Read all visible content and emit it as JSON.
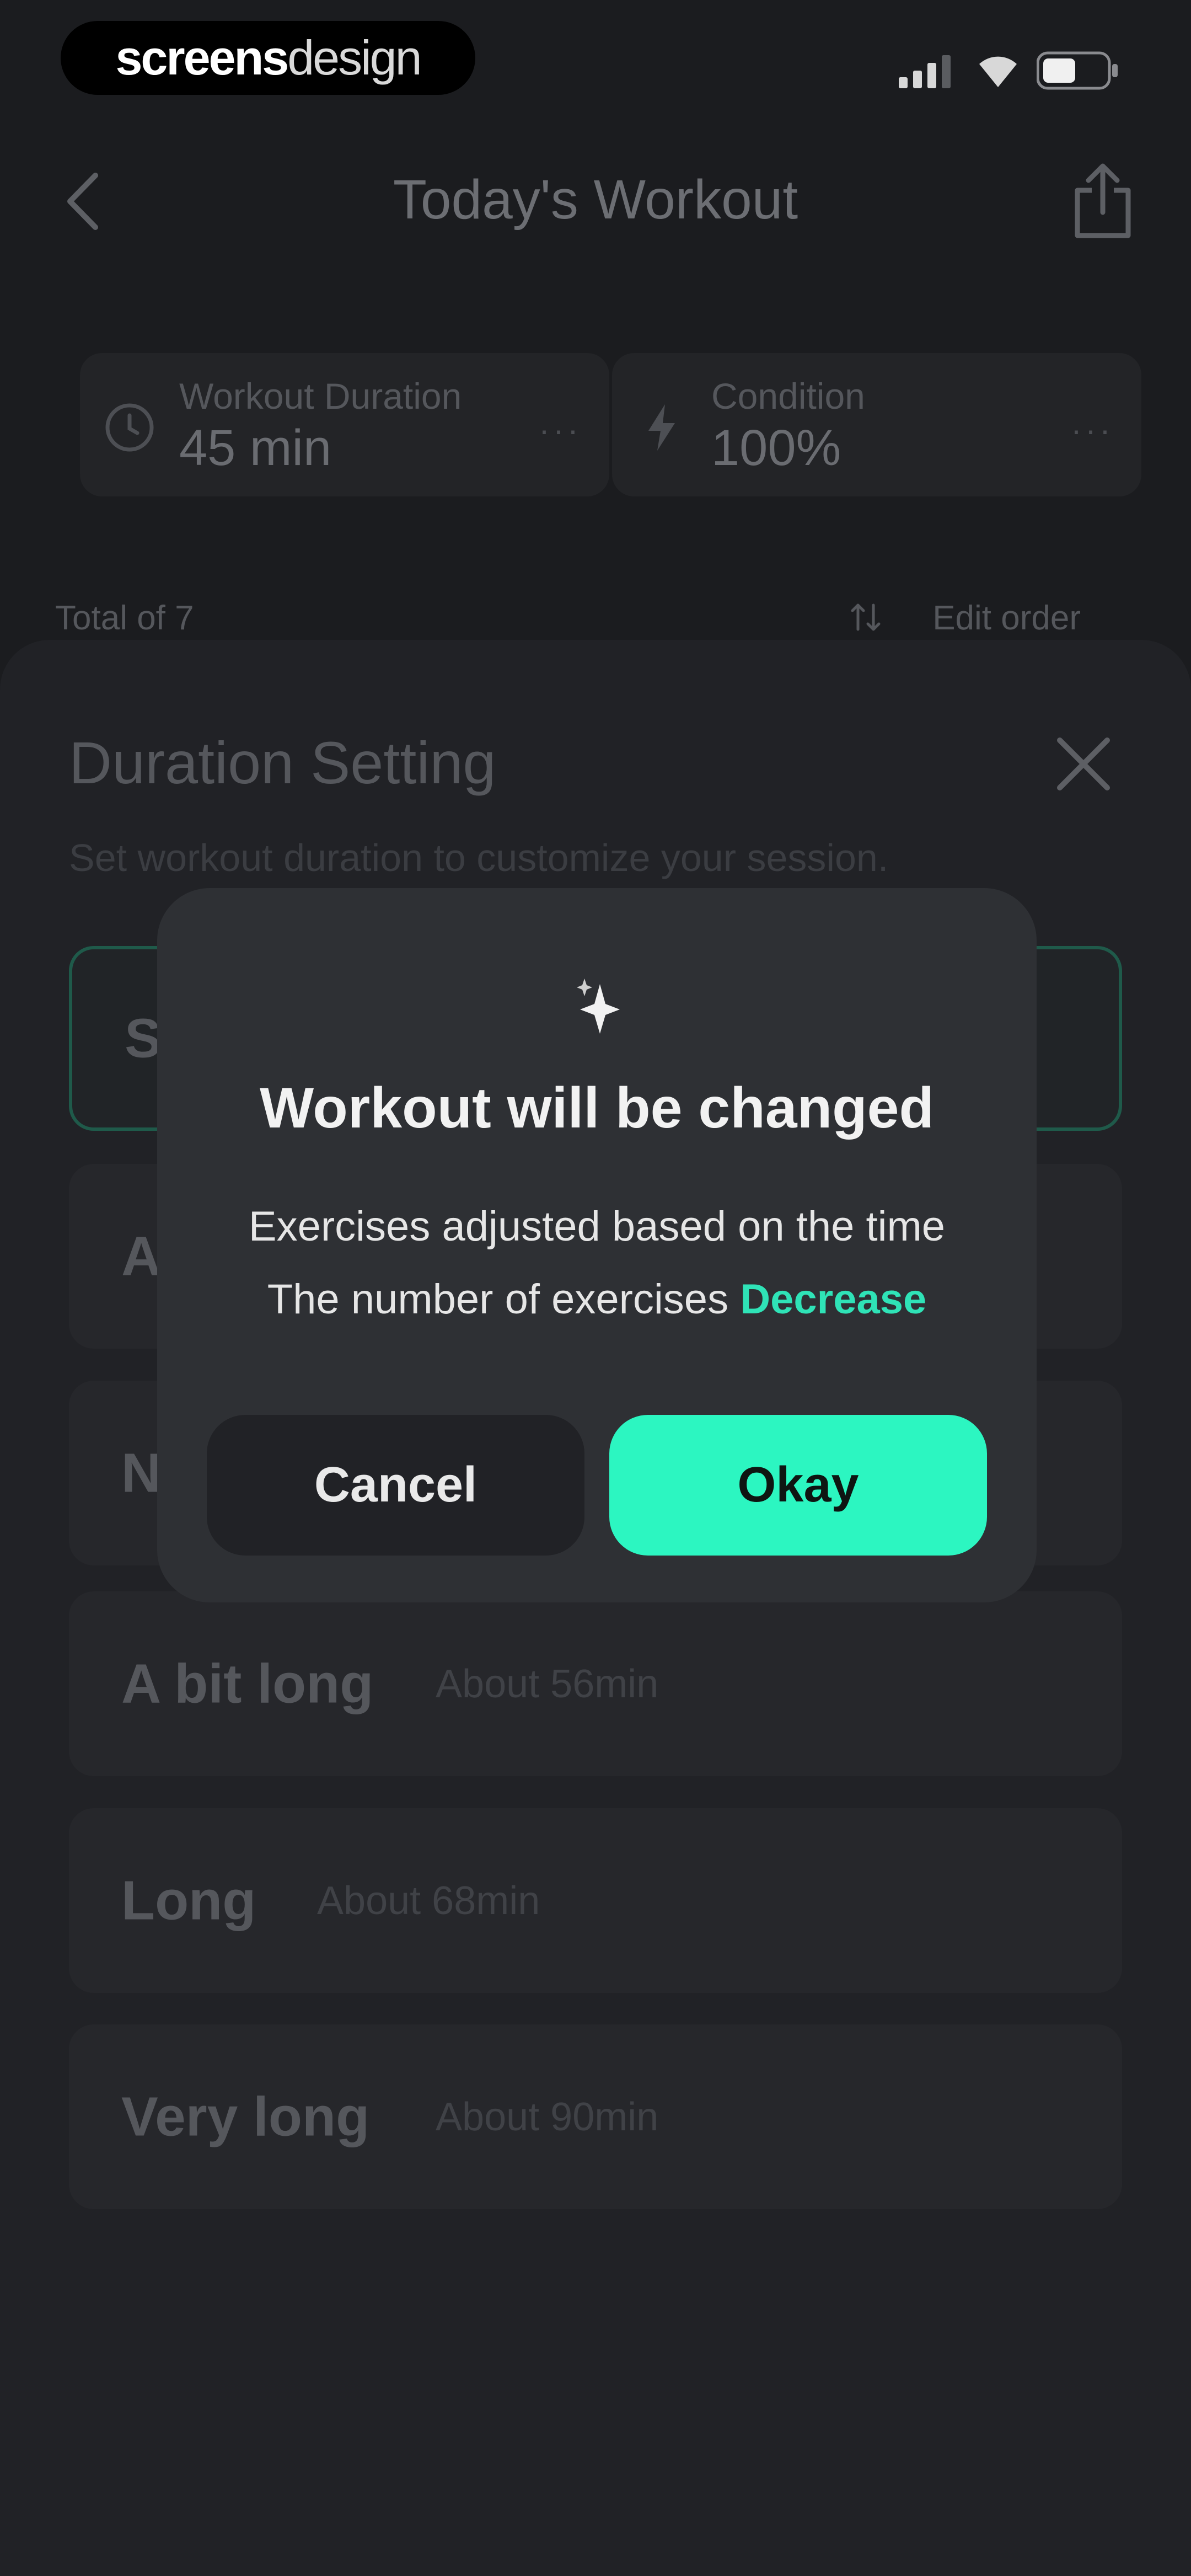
{
  "status_bar": {
    "brand_bold": "screens",
    "brand_light": "design"
  },
  "nav": {
    "title": "Today's Workout"
  },
  "stats": [
    {
      "label": "Workout Duration",
      "value": "45 min",
      "icon": "clock-icon"
    },
    {
      "label": "Condition",
      "value": "100%",
      "icon": "bolt-icon"
    }
  ],
  "list_meta": {
    "total": "Total of 7",
    "edit_order": "Edit order"
  },
  "sheet": {
    "title": "Duration Setting",
    "subtitle": "Set workout duration to customize your session.",
    "options": [
      {
        "label": "S",
        "detail": ""
      },
      {
        "label": "A",
        "detail": ""
      },
      {
        "label": "N",
        "detail": ""
      },
      {
        "label": "A bit long",
        "detail": "About 56min"
      },
      {
        "label": "Long",
        "detail": "About 68min"
      },
      {
        "label": "Very long",
        "detail": "About 90min"
      }
    ],
    "selected_index": 0
  },
  "modal": {
    "icon": "sparkle-icon",
    "title": "Workout will be changed",
    "line1": "Exercises adjusted based on the time",
    "line2_prefix": "The number of exercises ",
    "line2_accent": "Decrease",
    "cancel_label": "Cancel",
    "okay_label": "Okay"
  },
  "colors": {
    "accent": "#2cf6c1",
    "accent_text": "#2fe3b7",
    "background": "#1b1c1f",
    "modal": "#2e3034"
  }
}
